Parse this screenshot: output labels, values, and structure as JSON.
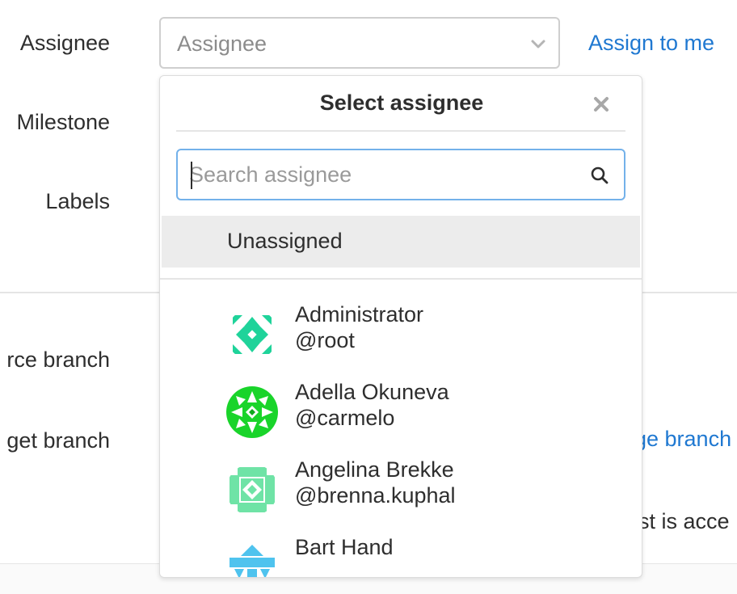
{
  "form": {
    "assignee_label": "Assignee",
    "milestone_label": "Milestone",
    "labels_label": "Labels",
    "source_branch_label": "rce branch",
    "target_branch_label": "get branch",
    "assign_to_me": "Assign to me",
    "change_branch_partial": "ge branch",
    "accept_partial": "st is acce"
  },
  "assignee_select": {
    "placeholder": "Assignee",
    "chevron_icon": "chevron-down-icon"
  },
  "dropdown": {
    "title": "Select assignee",
    "close_icon": "close-icon",
    "search_placeholder": "Search assignee",
    "search_icon": "search-icon",
    "unassigned_label": "Unassigned",
    "users": [
      {
        "name": "Administrator",
        "username": "@root",
        "avatar_color": "#1fd39a"
      },
      {
        "name": "Adella Okuneva",
        "username": "@carmelo",
        "avatar_color": "#19d42a"
      },
      {
        "name": "Angelina Brekke",
        "username": "@brenna.kuphal",
        "avatar_color": "#6fe3a6"
      },
      {
        "name": "Bart Hand",
        "username": "",
        "avatar_color": "#4fc3ee"
      }
    ]
  },
  "colors": {
    "link": "#1f78d1",
    "focus_border": "#73b1ea",
    "hover_row": "#ececec"
  }
}
